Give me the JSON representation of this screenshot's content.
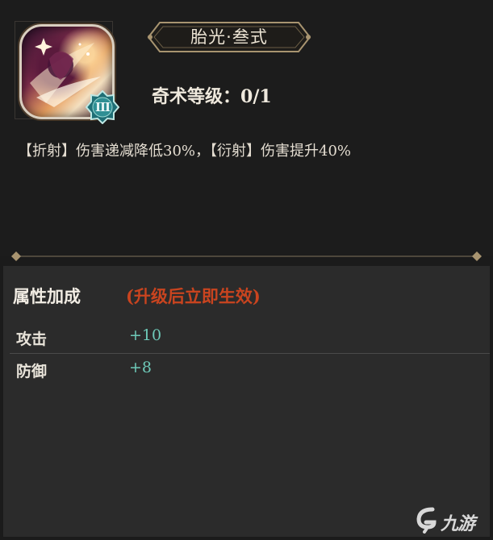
{
  "skill": {
    "name": "胎光·叁式",
    "tier": "III",
    "level_label": "奇术等级：",
    "level_value": "0/1",
    "description": "【折射】伤害递减降低30%，【衍射】伤害提升40%"
  },
  "attributes": {
    "title": "属性加成",
    "note": "(升级后立即生效)",
    "rows": [
      {
        "label": "攻击",
        "value": "+10"
      },
      {
        "label": "防御",
        "value": "+8"
      }
    ]
  },
  "watermark": {
    "text": "九游"
  },
  "colors": {
    "panel_bg": "#1c1c1c",
    "attr_bg": "#2b2b2b",
    "note_red": "#c9441f",
    "value_teal": "#6ec9b8",
    "gold_trim": "#a89470",
    "badge_teal": "#2f8f94"
  }
}
